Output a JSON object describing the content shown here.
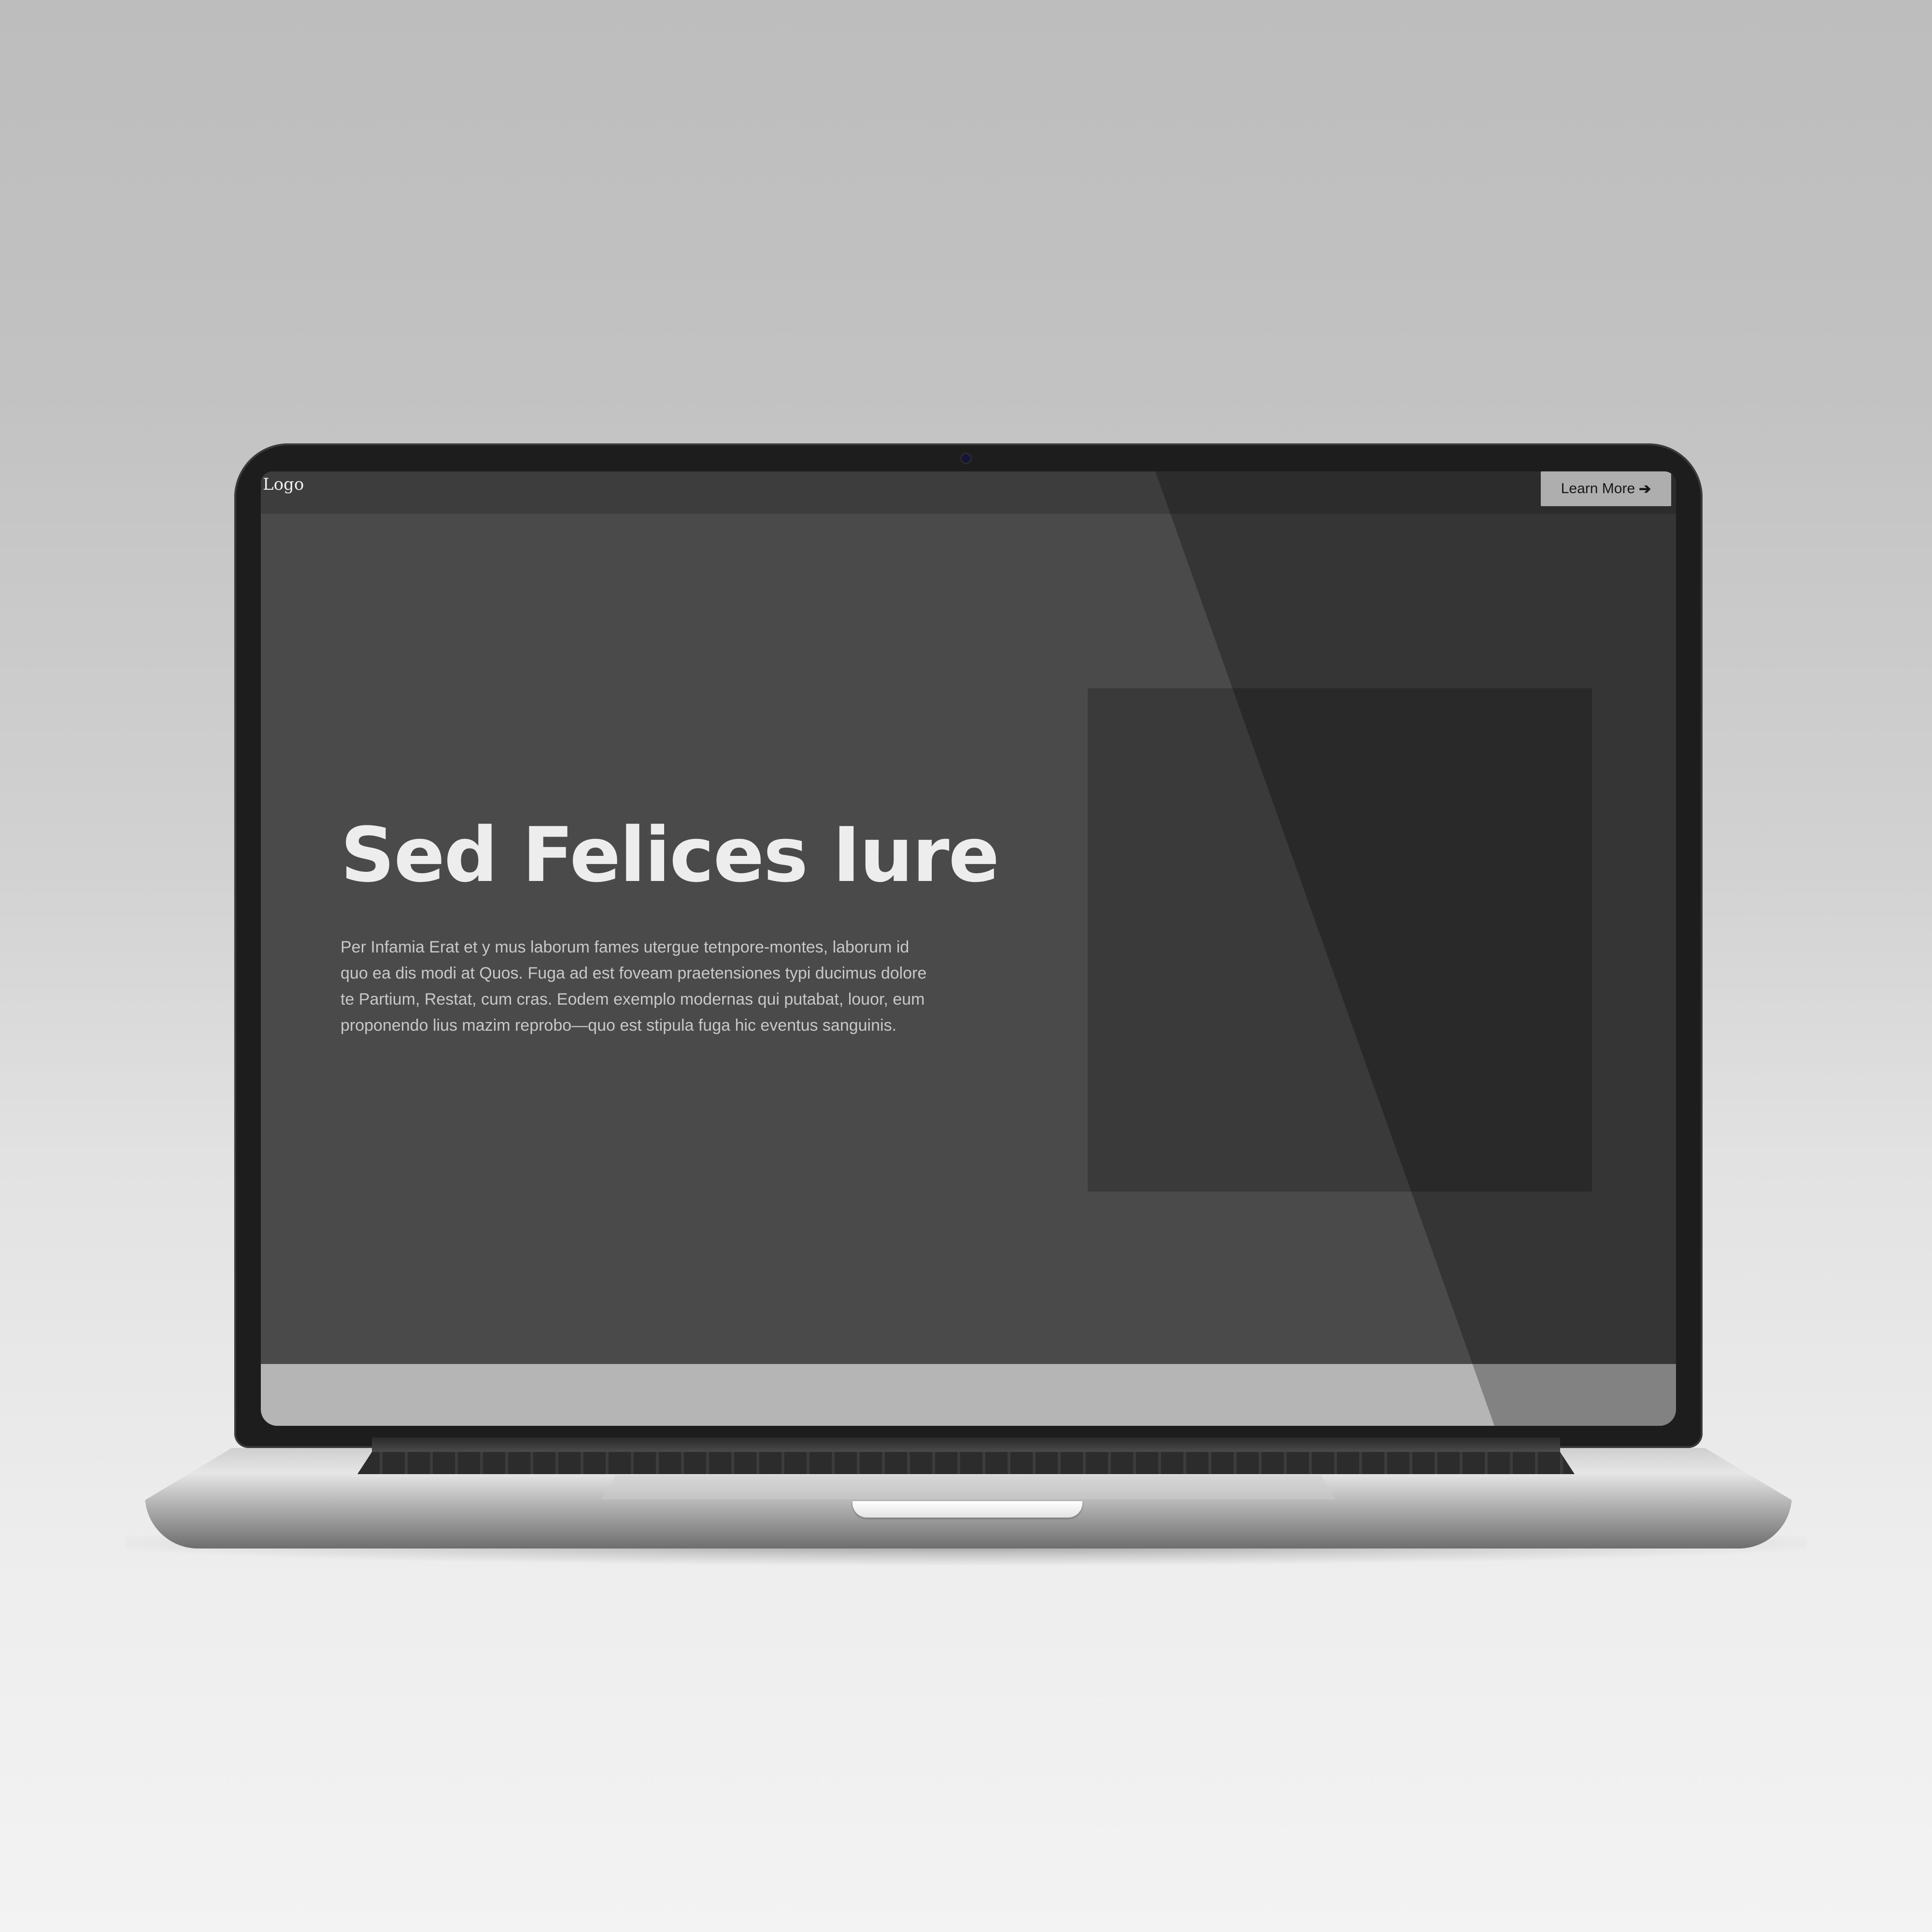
{
  "site": {
    "logo_text": "Logo",
    "cta_label": "Learn More",
    "cta_icon": "arrow-right-icon"
  },
  "hero": {
    "title": "Sed Felices Iure",
    "body": "Per Infamia Erat et y mus laborum fames utergue tetnpore-montes, laborum id quo ea dis modi at Quos. Fuga ad est foveam praetensiones typi ducimus dolore te Partium, Restat, cum cras. Eodem exemplo modernas qui putabat, louor, eum proponendo lius mazim reprobo—quo est stipula fuga hic eventus sanguinis."
  },
  "colors": {
    "page_bg": "#4a4a4a",
    "nav_bg": "#3d3d3d",
    "cta_bg": "#f1f1f1",
    "placeholder_bg": "#3a3a3a",
    "footer_band": "#b5b5b5"
  }
}
